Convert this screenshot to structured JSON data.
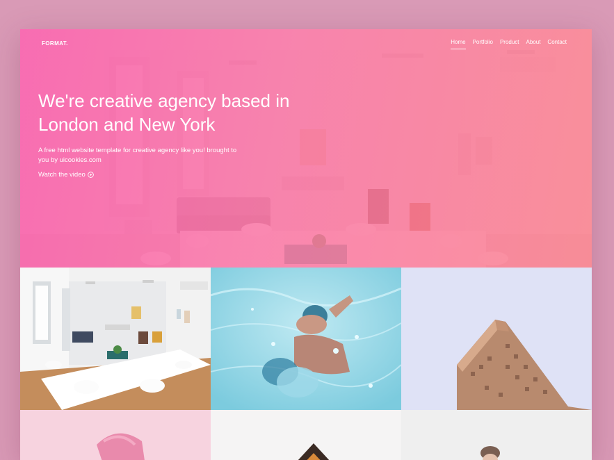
{
  "header": {
    "brand": "FORMAT.",
    "nav": [
      {
        "label": "Home",
        "active": true
      },
      {
        "label": "Portfolio",
        "active": false
      },
      {
        "label": "Product",
        "active": false
      },
      {
        "label": "About",
        "active": false
      },
      {
        "label": "Contact",
        "active": false
      }
    ]
  },
  "hero": {
    "title": "We're creative agency based in London and New York",
    "description": "A free html website template for creative agency like you! brought to you by uicookies.com",
    "cta_label": "Watch the video",
    "cta_icon": "play-circle-icon"
  },
  "colors": {
    "overlay_start": "#f85caa",
    "overlay_end": "#fa808c",
    "page_background": "#d99ab6"
  },
  "gallery": {
    "tiles": [
      {
        "subject": "white-office-interior"
      },
      {
        "subject": "swimmer-underwater"
      },
      {
        "subject": "flatiron-building"
      },
      {
        "subject": "pink-fabric"
      },
      {
        "subject": "house-roof"
      },
      {
        "subject": "person-portrait"
      }
    ]
  }
}
